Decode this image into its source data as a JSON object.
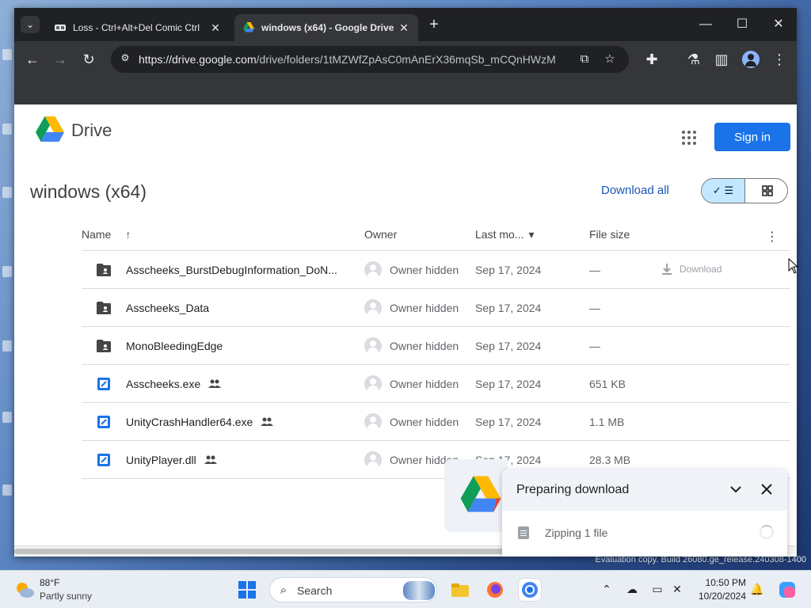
{
  "browser": {
    "tabs": [
      {
        "title": "Loss - Ctrl+Alt+Del Comic Ctrl",
        "active": false
      },
      {
        "title": "windows (x64) - Google Drive",
        "active": true
      }
    ],
    "url_host": "https://drive.google.com",
    "url_path": "/drive/folders/1tMZWfZpAsC0mAnErX36mqSb_mCQnHWzM"
  },
  "header": {
    "product_name": "Drive",
    "sign_in_label": "Sign in"
  },
  "folder": {
    "title": "windows (x64)",
    "download_all_label": "Download all",
    "view_mode": "list"
  },
  "columns": {
    "name": "Name",
    "owner": "Owner",
    "last_modified": "Last mo...",
    "file_size": "File size"
  },
  "files": [
    {
      "name": "Asscheeks_BurstDebugInformation_DoN...",
      "type": "folder",
      "shared": false,
      "owner": "Owner hidden",
      "date": "Sep 17, 2024",
      "size": "—",
      "hover_action": "Download"
    },
    {
      "name": "Asscheeks_Data",
      "type": "folder",
      "shared": false,
      "owner": "Owner hidden",
      "date": "Sep 17, 2024",
      "size": "—"
    },
    {
      "name": "MonoBleedingEdge",
      "type": "folder",
      "shared": false,
      "owner": "Owner hidden",
      "date": "Sep 17, 2024",
      "size": "—"
    },
    {
      "name": "Asscheeks.exe",
      "type": "exe",
      "shared": true,
      "owner": "Owner hidden",
      "date": "Sep 17, 2024",
      "size": "651 KB"
    },
    {
      "name": "UnityCrashHandler64.exe",
      "type": "exe",
      "shared": true,
      "owner": "Owner hidden",
      "date": "Sep 17, 2024",
      "size": "1.1 MB"
    },
    {
      "name": "UnityPlayer.dll",
      "type": "exe",
      "shared": true,
      "owner": "Owner hidden",
      "date": "Sep 17, 2024",
      "size": "28.3 MB"
    }
  ],
  "download_toast": {
    "title": "Preparing download",
    "status": "Zipping 1 file"
  },
  "desktop": {
    "eval_line1": "Evaluation copy. Build 26080.ge_release.240308-1400"
  },
  "taskbar": {
    "temperature": "88°F",
    "weather": "Partly sunny",
    "search_placeholder": "Search",
    "time": "10:50 PM",
    "date": "10/20/2024"
  },
  "colors": {
    "accent": "#1a73e8",
    "toolbar": "#35363a",
    "tabbar": "#202124"
  }
}
